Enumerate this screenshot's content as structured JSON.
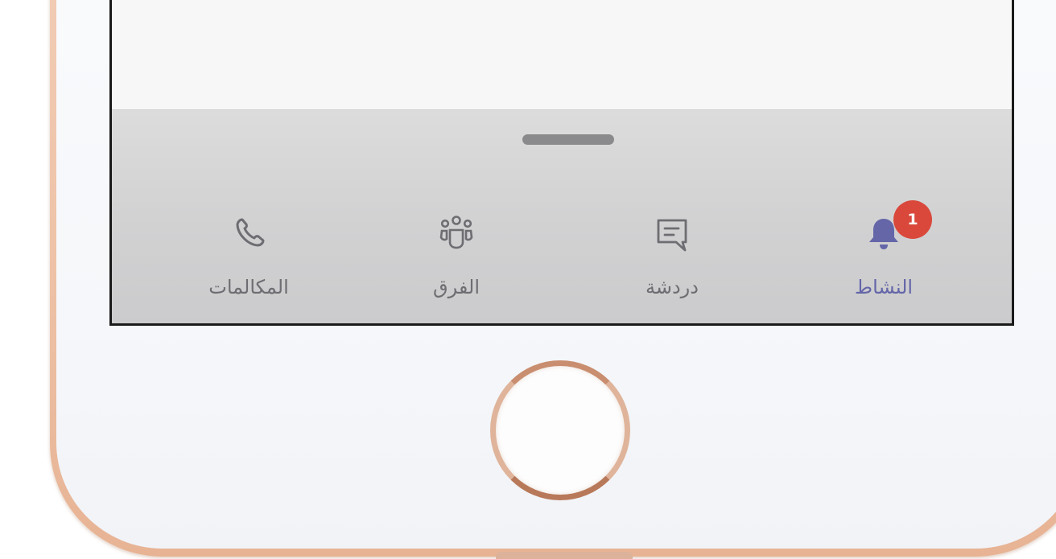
{
  "tab_bar": {
    "tabs": [
      {
        "id": "calls",
        "label": "المكالمات",
        "icon": "phone-icon",
        "active": false
      },
      {
        "id": "teams",
        "label": "الفرق",
        "icon": "teams-icon",
        "active": false
      },
      {
        "id": "chat",
        "label": "دردشة",
        "icon": "chat-icon",
        "active": false
      },
      {
        "id": "activity",
        "label": "النشاط",
        "icon": "bell-icon",
        "active": true,
        "badge": "1"
      }
    ]
  },
  "colors": {
    "accent": "#6466a8",
    "badge": "#d9483b",
    "inactive": "#6d6d72",
    "frame": "#eec3a8"
  }
}
